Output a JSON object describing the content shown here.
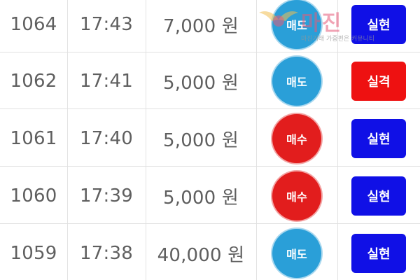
{
  "watermark": {
    "brand": "마진",
    "subtitle": "마진거래 가중편은 커뮤니티"
  },
  "colors": {
    "sell": "#2a9fd8",
    "buy": "#e21d1d",
    "realized": "#1010e6",
    "liquidated": "#ee1111"
  },
  "rows": [
    {
      "id": "1064",
      "time": "17:43",
      "amount": "7,000 원",
      "side": "매도",
      "side_type": "sell",
      "result": "실현",
      "result_type": "realized"
    },
    {
      "id": "1062",
      "time": "17:41",
      "amount": "5,000 원",
      "side": "매도",
      "side_type": "sell",
      "result": "실격",
      "result_type": "liquidated"
    },
    {
      "id": "1061",
      "time": "17:40",
      "amount": "5,000 원",
      "side": "매수",
      "side_type": "buy",
      "result": "실현",
      "result_type": "realized"
    },
    {
      "id": "1060",
      "time": "17:39",
      "amount": "5,000 원",
      "side": "매수",
      "side_type": "buy",
      "result": "실현",
      "result_type": "realized"
    },
    {
      "id": "1059",
      "time": "17:38",
      "amount": "40,000 원",
      "side": "매도",
      "side_type": "sell",
      "result": "실현",
      "result_type": "realized"
    }
  ]
}
